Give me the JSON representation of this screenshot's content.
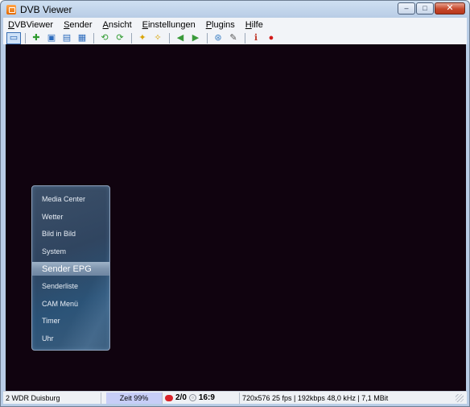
{
  "window": {
    "title": "DVB Viewer",
    "controls": {
      "minimize": "–",
      "maximize": "□",
      "close": "✕"
    }
  },
  "menubar": [
    {
      "prefix": "",
      "underlined": "D",
      "rest": "VBViewer"
    },
    {
      "prefix": "",
      "underlined": "S",
      "rest": "ender"
    },
    {
      "prefix": "",
      "underlined": "A",
      "rest": "nsicht"
    },
    {
      "prefix": "",
      "underlined": "E",
      "rest": "instellungen"
    },
    {
      "prefix": "",
      "underlined": "P",
      "rest": "lugins"
    },
    {
      "prefix": "",
      "underlined": "H",
      "rest": "ilfe"
    }
  ],
  "toolbar": {
    "icons": [
      {
        "name": "fullscreen-icon",
        "glyph": "▭",
        "color": "#1f5fae",
        "selected": true
      },
      {
        "name": "add-channel-icon",
        "glyph": "✚",
        "color": "#2e9a2e"
      },
      {
        "name": "window-icon",
        "glyph": "▣",
        "color": "#2c6bbd"
      },
      {
        "name": "picture-icon",
        "glyph": "▤",
        "color": "#2c6bbd"
      },
      {
        "name": "screen-icon",
        "glyph": "▦",
        "color": "#2c6bbd"
      },
      {
        "name": "rewind-icon",
        "glyph": "⟲",
        "color": "#2e9a2e"
      },
      {
        "name": "forward-icon",
        "glyph": "⟳",
        "color": "#2e9a2e"
      },
      {
        "name": "favorite-up-icon",
        "glyph": "✦",
        "color": "#d9a300"
      },
      {
        "name": "favorite-down-icon",
        "glyph": "✧",
        "color": "#d9a300"
      },
      {
        "name": "prev-channel-icon",
        "glyph": "◀",
        "color": "#3a9a3a"
      },
      {
        "name": "next-channel-icon",
        "glyph": "▶",
        "color": "#3a9a3a"
      },
      {
        "name": "network-icon",
        "glyph": "⊛",
        "color": "#3b7fc4"
      },
      {
        "name": "tools-icon",
        "glyph": "✎",
        "color": "#555555"
      },
      {
        "name": "info-icon",
        "glyph": "ℹ",
        "color": "#c0392b"
      },
      {
        "name": "record-icon",
        "glyph": "●",
        "color": "#d21a1a"
      }
    ]
  },
  "osd_menu": {
    "items": [
      "Media Center",
      "Wetter",
      "Bild in Bild",
      "System",
      "Sender EPG",
      "Senderliste",
      "CAM Menü",
      "Timer",
      "Uhr"
    ],
    "selected_index": 4
  },
  "statusbar": {
    "channel": "2 WDR Duisburg",
    "time_shift": "Zeit 99%",
    "recordings": "2/0",
    "aspect": "16:9",
    "stream_info": "720x576 25 fps | 192kbps 48,0 kHz | 7,1 MBit"
  },
  "colors": {
    "video_background": "#10030f",
    "osd_selected": "#8aa0b8",
    "time_shift_bg": "#c7cef7"
  }
}
